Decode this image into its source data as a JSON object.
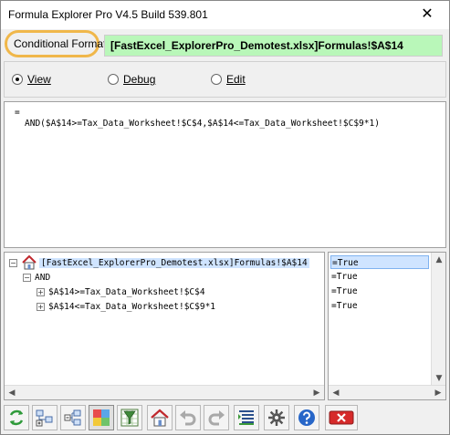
{
  "window": {
    "title": "Formula Explorer Pro V4.5 Build 539.801",
    "close_label": "✕"
  },
  "header": {
    "conditional_format_label": "Conditional Format",
    "address": "[FastExcel_ExplorerPro_Demotest.xlsx]Formulas!$A$14",
    "address_bg": "#b9f7b9",
    "highlight_color": "#f0b74a"
  },
  "modes": {
    "selected": "View",
    "items": [
      {
        "label": "View",
        "selected": true
      },
      {
        "label": "Debug",
        "selected": false
      },
      {
        "label": "Edit",
        "selected": false
      }
    ]
  },
  "formula": {
    "prefix": "=",
    "text": "AND($A$14>=Tax_Data_Worksheet!$C$4,$A$14<=Tax_Data_Worksheet!$C$9*1)"
  },
  "tree": {
    "root": "[FastExcel_ExplorerPro_Demotest.xlsx]Formulas!$A$14",
    "nodes": [
      {
        "label": "AND",
        "expander": "−"
      },
      {
        "label": "$A$14>=Tax_Data_Worksheet!$C$4",
        "expander": "+"
      },
      {
        "label": "$A$14<=Tax_Data_Worksheet!$C$9*1",
        "expander": "+"
      }
    ],
    "root_expander": "−"
  },
  "results": {
    "values": [
      "=True",
      "=True",
      "=True",
      "=True"
    ]
  },
  "scroll": {
    "left": "◀",
    "right": "▶",
    "up": "▲",
    "down": "▼"
  },
  "toolbar": {
    "buttons": [
      {
        "icon": "refresh-icon"
      },
      {
        "icon": "expand-tree-icon"
      },
      {
        "icon": "collapse-tree-icon"
      },
      {
        "icon": "color-grid-icon"
      },
      {
        "icon": "filter-icon"
      },
      {
        "icon": "home-icon"
      },
      {
        "icon": "undo-icon"
      },
      {
        "icon": "redo-icon"
      },
      {
        "icon": "list-icon"
      },
      {
        "icon": "settings-icon"
      },
      {
        "icon": "help-icon"
      },
      {
        "icon": "exit-icon"
      }
    ],
    "colors": {
      "refresh": "#2e9a3a",
      "help": "#2766c8",
      "exit": "#d62a2a"
    }
  }
}
